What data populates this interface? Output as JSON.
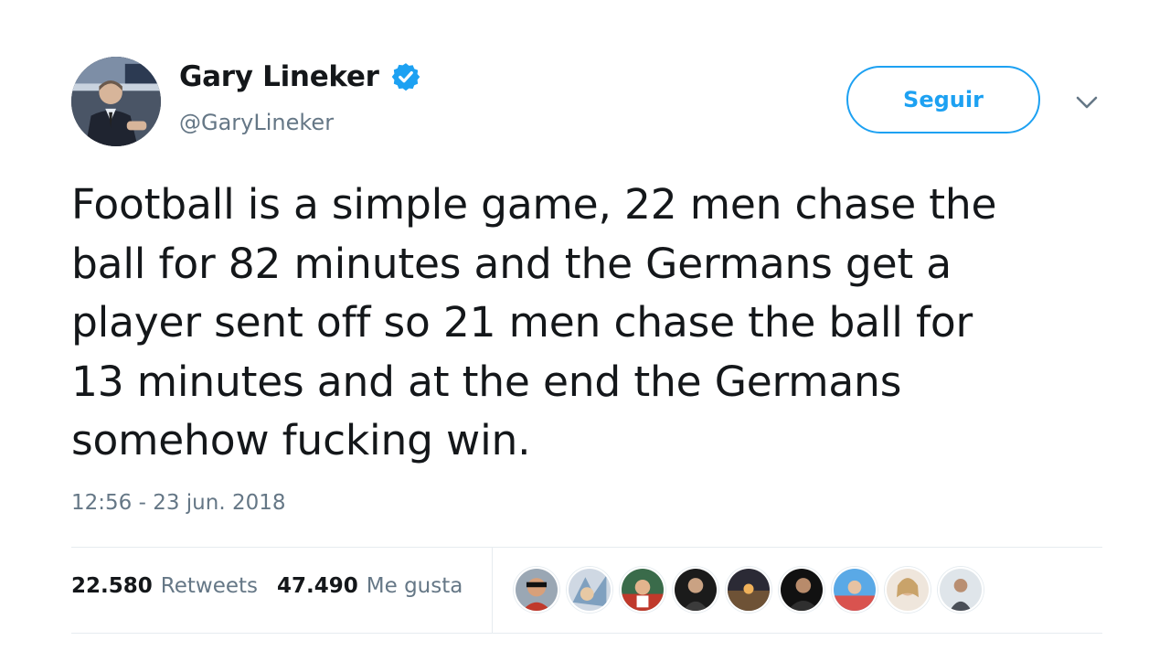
{
  "author": {
    "display_name": "Gary Lineker",
    "handle": "@GaryLineker",
    "verified": true,
    "avatar_icon": "profile-photo"
  },
  "actions": {
    "follow_label": "Seguir",
    "more_icon": "chevron-down-icon"
  },
  "tweet": {
    "text": "Football is a simple game, 22 men chase the\nball for 82 minutes and the Germans get a\nplayer sent off so 21 men chase the ball for\n13 minutes and at the end the Germans\nsomehow fucking win.",
    "timestamp": "12:56 - 23 jun. 2018"
  },
  "stats": {
    "retweets_count": "22.580",
    "retweets_label": "Retweets",
    "likes_count": "47.490",
    "likes_label": "Me gusta"
  },
  "liker_avatars": [
    "avatar-1",
    "avatar-2",
    "avatar-3",
    "avatar-4",
    "avatar-5",
    "avatar-6",
    "avatar-7",
    "avatar-8",
    "avatar-9"
  ],
  "colors": {
    "accent": "#1da1f2",
    "text": "#14171a",
    "secondary": "#657786",
    "divider": "#e6ecf0"
  }
}
